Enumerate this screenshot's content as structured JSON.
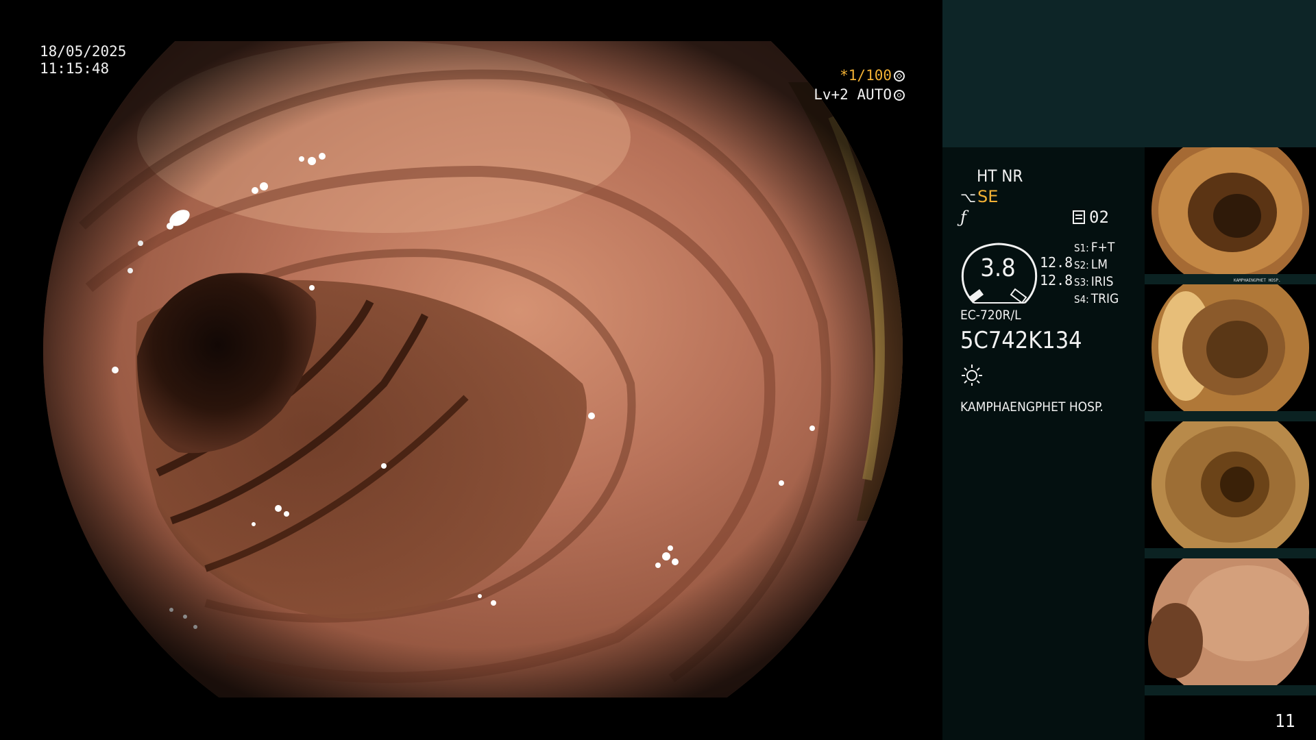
{
  "overlay": {
    "date": "18/05/2025",
    "time": "11:15:48",
    "shutter_prefix": "*",
    "shutter_value": "1/100",
    "level": "Lv+2 AUTO"
  },
  "info": {
    "ht_nr": "HT NR",
    "se": "SE",
    "memo_count": "02",
    "gauge_value": "3.8",
    "gauge_val_1": "12.8",
    "gauge_val_2": "12.8",
    "switches": [
      {
        "key": "S1:",
        "value": "F+T"
      },
      {
        "key": "S2:",
        "value": "LM"
      },
      {
        "key": "S3:",
        "value": "IRIS"
      },
      {
        "key": "S4:",
        "value": "TRIG"
      }
    ],
    "scope_model": "EC-720R/L",
    "scope_serial": "5C742K134",
    "hospital": "KAMPHAENGPHET HOSP."
  },
  "thumbnails": [
    {
      "index": 1
    },
    {
      "index": 2
    },
    {
      "index": 3
    },
    {
      "index": 4
    }
  ],
  "page_number": "11",
  "colors": {
    "accent_orange": "#f2b135",
    "panel_top": "#0d2527",
    "panel_info": "#041010"
  }
}
